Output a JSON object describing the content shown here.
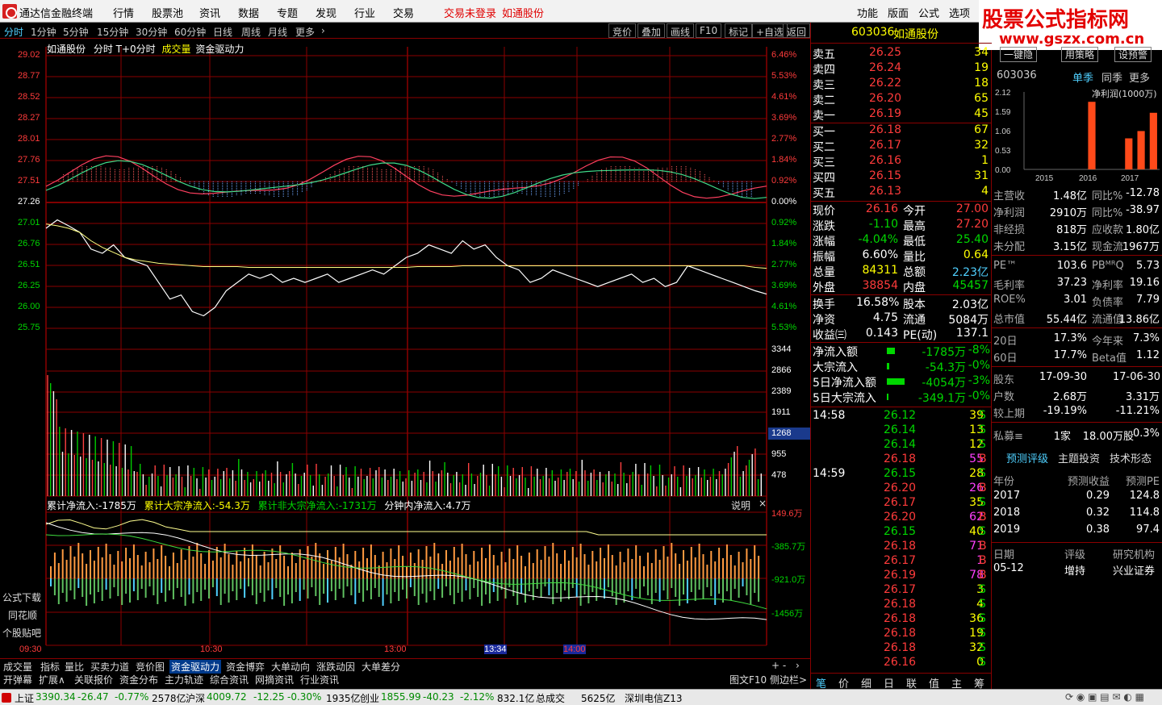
{
  "titlebar": {
    "app_name": "通达信金融终端",
    "menu": [
      "行情",
      "股票池",
      "资讯",
      "数据",
      "专题",
      "发现",
      "行业",
      "交易"
    ],
    "login_status": "交易未登录",
    "stock_name": "如通股份",
    "right_menu": [
      "功能",
      "版面",
      "公式",
      "选项"
    ]
  },
  "brand": {
    "line1": "股票公式指标网",
    "line2": "www.gszx.com.cn"
  },
  "periods": [
    "分时",
    "1分钟",
    "5分钟",
    "15分钟",
    "30分钟",
    "60分钟",
    "日线",
    "周线",
    "月线",
    "更多"
  ],
  "toolbar_buttons": [
    "竞价",
    "叠加",
    "画线",
    "F10",
    "标记",
    "+自选",
    "返回"
  ],
  "chart_header": {
    "name": "如通股份",
    "mode": "分时 T+0分时",
    "vol": "成交量",
    "extra": "资金驱动力"
  },
  "chart_data": [
    {
      "type": "line",
      "title": "",
      "price_ticks": [
        "29.02",
        "28.77",
        "28.52",
        "28.27",
        "28.01",
        "27.76",
        "27.51",
        "27.26",
        "27.01",
        "26.76",
        "26.51",
        "26.25",
        "26.00",
        "25.75"
      ],
      "pct_ticks": [
        "6.46%",
        "5.53%",
        "4.61%",
        "3.69%",
        "2.77%",
        "1.84%",
        "0.92%",
        "0.00%",
        "0.92%",
        "1.84%",
        "2.77%",
        "3.69%",
        "4.61%",
        "5.53%"
      ],
      "ylim": [
        25.75,
        29.02
      ],
      "x_labels": [
        "09:30",
        "10:30",
        "13:00",
        "13:34",
        "14:00"
      ],
      "price_series": [
        26.95,
        27.05,
        26.98,
        26.9,
        26.7,
        26.65,
        26.75,
        26.6,
        26.55,
        26.5,
        26.3,
        26.1,
        26.15,
        25.95,
        25.9,
        26.0,
        26.2,
        26.3,
        26.4,
        26.35,
        26.4,
        26.3,
        26.35,
        26.3,
        26.35,
        26.4,
        26.3,
        26.35,
        26.4,
        26.45,
        26.4,
        26.5,
        26.6,
        26.65,
        26.75,
        26.7,
        26.65,
        26.8,
        26.7,
        26.75,
        26.6,
        26.5,
        26.45,
        26.3,
        26.35,
        26.45,
        26.4,
        26.35,
        26.3,
        26.25,
        26.3,
        26.35,
        26.4,
        26.3,
        26.35,
        26.25,
        26.3,
        26.5,
        26.45,
        26.4,
        26.35,
        26.3,
        26.25,
        26.2,
        26.16
      ],
      "avg_series": [
        27.0,
        26.98,
        26.95,
        26.9,
        26.8,
        26.72,
        26.66,
        26.6,
        26.57,
        26.55,
        26.53,
        26.52,
        26.51,
        26.5,
        26.49,
        26.49,
        26.49,
        26.49,
        26.48,
        26.48,
        26.48,
        26.48,
        26.48,
        26.48,
        26.48,
        26.48,
        26.48,
        26.48,
        26.48,
        26.48,
        26.48,
        26.48,
        26.48,
        26.49,
        26.49,
        26.49,
        26.49,
        26.5,
        26.5,
        26.5,
        26.5,
        26.5,
        26.5,
        26.5,
        26.5,
        26.5,
        26.5,
        26.5,
        26.5,
        26.5,
        26.5,
        26.5,
        26.5,
        26.5,
        26.5,
        26.5,
        26.5,
        26.5,
        26.5,
        26.5,
        26.5,
        26.5,
        26.5,
        26.48,
        26.47
      ]
    },
    {
      "type": "bar",
      "title": "",
      "volume_ticks": [
        "3344",
        "2866",
        "2389",
        "1911",
        "1268",
        "955",
        "478"
      ],
      "ylim": [
        0,
        3344
      ]
    },
    {
      "type": "line",
      "title": "",
      "legend": [
        "累计净流入:-1785万",
        "累计大宗净流入:-54.3万",
        "累计非大宗净流入:-1731万",
        "分钟内净流入:4.7万"
      ],
      "ticks": [
        "149.6万",
        "-385.7万",
        "-921.0万",
        "-1456万"
      ]
    }
  ],
  "explain_label": "说明",
  "side_links": [
    "公式下载",
    "同花顺",
    "个股贴吧"
  ],
  "quote": {
    "code": "603036",
    "name": "如通股份",
    "asks": [
      [
        "卖五",
        "26.25",
        "34"
      ],
      [
        "卖四",
        "26.24",
        "19"
      ],
      [
        "卖三",
        "26.22",
        "18"
      ],
      [
        "卖二",
        "26.20",
        "65"
      ],
      [
        "卖一",
        "26.19",
        "45"
      ]
    ],
    "bids": [
      [
        "买一",
        "26.18",
        "67"
      ],
      [
        "买二",
        "26.17",
        "32"
      ],
      [
        "买三",
        "26.16",
        "1"
      ],
      [
        "买四",
        "26.15",
        "31"
      ],
      [
        "买五",
        "26.13",
        "4"
      ]
    ],
    "stats": [
      [
        "现价",
        "26.16",
        "今开",
        "27.00"
      ],
      [
        "涨跌",
        "-1.10",
        "最高",
        "27.20"
      ],
      [
        "涨幅",
        "-4.04%",
        "最低",
        "25.40"
      ],
      [
        "振幅",
        "6.60%",
        "量比",
        "0.64"
      ],
      [
        "总量",
        "84311",
        "总额",
        "2.23亿"
      ],
      [
        "外盘",
        "38854",
        "内盘",
        "45457"
      ]
    ],
    "stats2": [
      [
        "换手",
        "16.58%",
        "股本",
        "2.03亿"
      ],
      [
        "净资",
        "4.75",
        "流通",
        "5084万"
      ],
      [
        "收益㈢",
        "0.143",
        "PE(动)",
        "137.1"
      ]
    ],
    "flows": [
      [
        "净流入额",
        "-1785万",
        "-8%"
      ],
      [
        "大宗流入",
        "-54.3万",
        "-0%"
      ],
      [
        "5日净流入额",
        "-4054万",
        "-3%"
      ],
      [
        "5日大宗流入",
        "-349.1万",
        "-0%"
      ]
    ],
    "ticks": [
      [
        "14:58",
        "26.12",
        "39",
        "S"
      ],
      [
        "",
        "26.14",
        "13",
        "S"
      ],
      [
        "",
        "26.14",
        "12",
        "S"
      ],
      [
        "",
        "26.18",
        "55",
        "B"
      ],
      [
        "14:59",
        "26.15",
        "28",
        "S"
      ],
      [
        "",
        "26.20",
        "26",
        "B"
      ],
      [
        "",
        "26.17",
        "35",
        "S"
      ],
      [
        "",
        "26.20",
        "62",
        "B"
      ],
      [
        "",
        "26.15",
        "40",
        "S"
      ],
      [
        "",
        "26.18",
        "71",
        "B"
      ],
      [
        "",
        "26.17",
        "1",
        "B"
      ],
      [
        "",
        "26.19",
        "78",
        "B"
      ],
      [
        "",
        "26.17",
        "3",
        "S"
      ],
      [
        "",
        "26.18",
        "4",
        "S"
      ],
      [
        "",
        "26.18",
        "36",
        "S"
      ],
      [
        "",
        "26.18",
        "19",
        "S"
      ],
      [
        "",
        "26.18",
        "32",
        "S"
      ],
      [
        "",
        "26.16",
        "0",
        "S"
      ]
    ],
    "bottom_tabs": [
      "笔",
      "价",
      "细",
      "日",
      "联",
      "值",
      "主",
      "筹"
    ]
  },
  "fundamentals": {
    "buttons": [
      "一键隐",
      "用策略",
      "设预警"
    ],
    "code": "603036",
    "season_tabs": [
      "单季",
      "同季",
      "更多"
    ],
    "profit_chart": {
      "ylabel": "净利润(1000万)",
      "ticks": [
        "2.12",
        "1.59",
        "1.06",
        "0.53",
        "0.00"
      ],
      "years": [
        "2015",
        "2016",
        "2017"
      ],
      "bars": [
        0,
        0,
        0,
        0,
        0,
        1.85,
        0,
        0,
        0.85,
        1.05,
        1.55
      ],
      "ylim": [
        0,
        2.12
      ]
    },
    "rows": [
      [
        "主营收",
        "1.48亿",
        "同比%",
        "-12.78"
      ],
      [
        "净利润",
        "2910万",
        "同比%",
        "-38.97"
      ],
      [
        "非经损",
        "818万",
        "应收款",
        "1.80亿"
      ],
      [
        "未分配",
        "3.15亿",
        "现金流",
        "1967万"
      ],
      [
        "PE™",
        "103.6",
        "PBᴹᴿQ",
        "5.73"
      ],
      [
        "毛利率",
        "37.23",
        "净利率",
        "19.16"
      ],
      [
        "ROE%",
        "3.01",
        "负债率",
        "7.79"
      ],
      [
        "总市值",
        "55.44亿",
        "流通值",
        "13.86亿"
      ],
      [
        "20日",
        "17.3%",
        "今年来",
        "7.3%"
      ],
      [
        "60日",
        "17.7%",
        "Beta值",
        "1.12"
      ],
      [
        "股东",
        "17-09-30",
        "",
        "17-06-30"
      ],
      [
        "户数",
        "2.68万",
        "",
        "3.31万"
      ],
      [
        "较上期",
        "-19.19%",
        "",
        "-11.21%"
      ],
      [
        "私募≡",
        "1家",
        "18.00万股",
        "0.3%"
      ]
    ],
    "forecast_tabs": [
      "预测评级",
      "主题投资",
      "技术形态"
    ],
    "forecast_header": [
      "年份",
      "预测收益",
      "预测PE"
    ],
    "forecast": [
      [
        "2017",
        "0.29",
        "124.8"
      ],
      [
        "2018",
        "0.32",
        "114.8"
      ],
      [
        "2019",
        "0.38",
        "97.4"
      ]
    ],
    "rating_header": [
      "日期",
      "评级",
      "研究机构"
    ],
    "rating": [
      "05-12",
      "增持",
      "兴业证券"
    ]
  },
  "tabs_row1": [
    "成交量",
    "指标",
    "量比",
    "买卖力道",
    "竞价图",
    "资金驱动力",
    "资金博弈",
    "大单动向",
    "涨跌动因",
    "大单差分"
  ],
  "tabs_row2": [
    "开弹幕",
    "扩展∧",
    "关联报价",
    "资金分布",
    "主力轨迹",
    "综合资讯",
    "网摘资讯",
    "行业资讯"
  ],
  "tabs_right": [
    "图文F10",
    "侧边栏>"
  ],
  "statusbar": {
    "sh": [
      "上证",
      "3390.34",
      "-26.47",
      "-0.77%",
      "2578亿"
    ],
    "hs": [
      "沪深",
      "4009.72",
      "-12.25",
      "-0.30%",
      "1935亿"
    ],
    "cy": [
      "创业",
      "1855.99",
      "-40.23",
      "-2.12%",
      "832.1亿"
    ],
    "total_label": "总成交",
    "total": "5625亿",
    "server": "深圳电信Z13"
  }
}
